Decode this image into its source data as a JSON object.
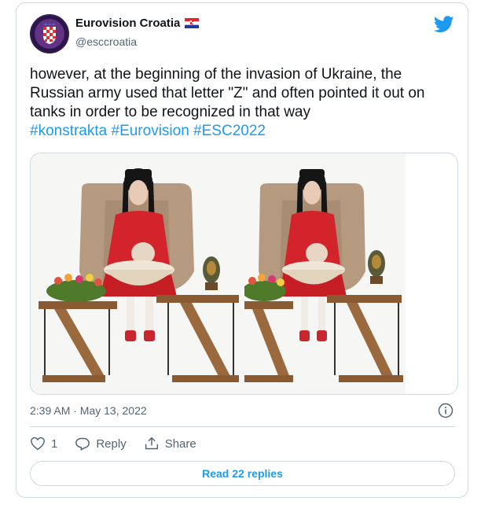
{
  "author": {
    "name": "Eurovision Croatia",
    "handle": "@esccroatia",
    "avatar_icon": "croatian-coat-of-arms-avatar",
    "flag_icon": "croatia-flag-icon"
  },
  "tweet": {
    "text": "however, at the beginning of the invasion of Ukraine, the Russian army used that letter \"Z\" and often pointed it out on tanks in order to be recognized in that way",
    "hashtags": "#konstrakta #Eurovision #ESC2022",
    "timestamp": "2:39 AM · May 13, 2022"
  },
  "actions": {
    "like_count": "1",
    "reply_label": "Reply",
    "share_label": "Share"
  },
  "read_replies_label": "Read 22 replies",
  "colors": {
    "accent": "#1d9bf0",
    "secondary_text": "#536471",
    "border": "#cfd9de"
  }
}
